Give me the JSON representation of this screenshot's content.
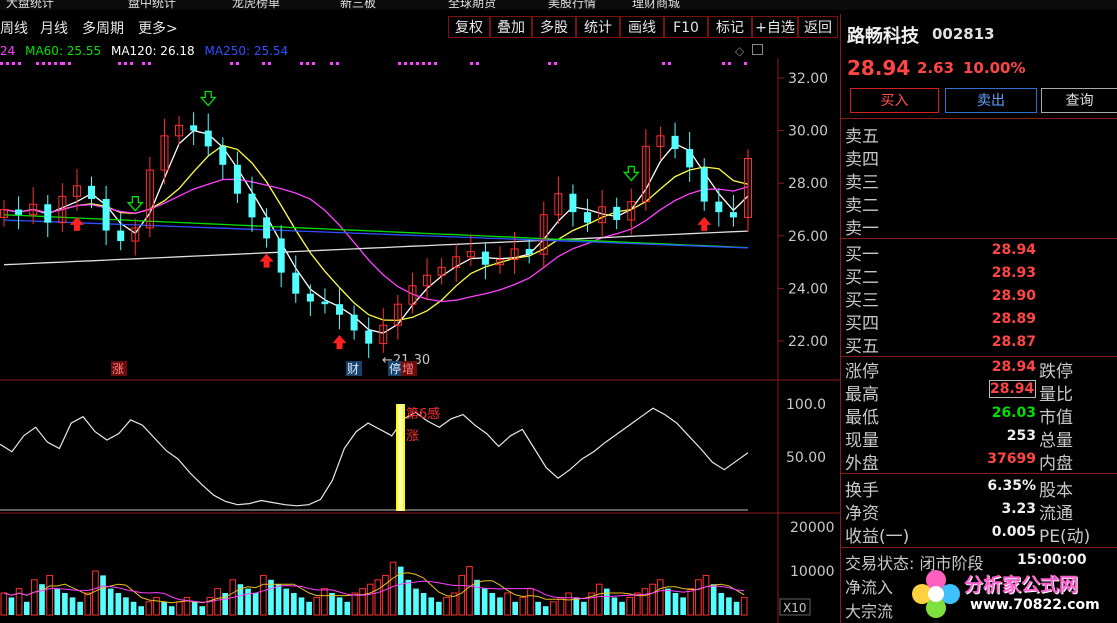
{
  "menu": {
    "items": [
      "大盘统计",
      "盘中统计",
      "龙虎榜单",
      "新三板",
      "全球期货",
      "美股行情",
      "理财商城"
    ]
  },
  "toolbar": {
    "left_items": [
      "周线",
      "月线",
      "多周期",
      "更多>"
    ],
    "buttons": [
      "复权",
      "叠加",
      "多股",
      "统计",
      "画线",
      "F10",
      "标记",
      "+自选",
      "返回"
    ]
  },
  "ma_legend": {
    "prefix": "24",
    "ma60": "MA60: 25.55",
    "ma120": "MA120: 26.18",
    "ma250": "MA250: 25.54",
    "colors": {
      "prefix": "#ff40ff",
      "ma60": "#00e000",
      "ma120": "#ffffff",
      "ma250": "#3050ff"
    }
  },
  "main_chart": {
    "y_ticks": [
      "32.00",
      "30.00",
      "28.00",
      "26.00",
      "24.00",
      "22.00"
    ],
    "low_label": "←21.30",
    "markers": [
      "涨",
      "财",
      "停",
      "增"
    ]
  },
  "indicator": {
    "y_ticks": [
      "100.0",
      "50.00"
    ],
    "signal_text_1": "第6感",
    "signal_text_2": "涨"
  },
  "volume": {
    "y_ticks": [
      "20000",
      "10000"
    ],
    "unit": "X10"
  },
  "chart_data": [
    {
      "type": "candlestick",
      "title": "",
      "y_range": [
        21,
        33
      ],
      "y_ticks": [
        32,
        30,
        28,
        26,
        24,
        22
      ],
      "close_approx": [
        27.0,
        26.8,
        27.2,
        26.5,
        27.5,
        27.9,
        27.4,
        26.2,
        25.8,
        26.3,
        28.5,
        29.8,
        30.2,
        30.0,
        29.4,
        28.7,
        27.6,
        26.7,
        25.9,
        24.6,
        23.8,
        23.5,
        23.4,
        23.0,
        22.4,
        21.9,
        22.6,
        23.4,
        24.1,
        24.5,
        24.8,
        25.2,
        25.4,
        24.9,
        25.1,
        25.5,
        25.3,
        26.8,
        27.6,
        26.9,
        26.5,
        27.1,
        26.6,
        27.3,
        29.4,
        29.8,
        29.3,
        28.6,
        27.3,
        26.9,
        26.7,
        28.94
      ],
      "low_marked": 21.3,
      "ma_values": {
        "MA60": 25.55,
        "MA120": 26.18,
        "MA250": 25.54
      }
    },
    {
      "type": "line",
      "title": "",
      "y_range": [
        0,
        110
      ],
      "y_ticks": [
        100,
        50
      ],
      "signal_bar": {
        "value": 100
      }
    },
    {
      "type": "bar",
      "title": "",
      "y_range": [
        0,
        22000
      ],
      "y_ticks": [
        20000,
        10000
      ],
      "unit": "X10"
    }
  ],
  "quote": {
    "name": "路畅科技",
    "code": "002813",
    "price": "28.94",
    "change": "2.63",
    "pct": "10.00%",
    "buy_btn": "买入",
    "sell_btn": "卖出",
    "query_btn": "查询"
  },
  "order_book": {
    "asks": [
      {
        "label": "卖五",
        "price": ""
      },
      {
        "label": "卖四",
        "price": ""
      },
      {
        "label": "卖三",
        "price": ""
      },
      {
        "label": "卖二",
        "price": ""
      },
      {
        "label": "卖一",
        "price": ""
      }
    ],
    "bids": [
      {
        "label": "买一",
        "price": "28.94"
      },
      {
        "label": "买二",
        "price": "28.93"
      },
      {
        "label": "买三",
        "price": "28.90"
      },
      {
        "label": "买四",
        "price": "28.89"
      },
      {
        "label": "买五",
        "price": "28.87"
      }
    ]
  },
  "stats": [
    {
      "label": "涨停",
      "value": "28.94",
      "label2": "跌停"
    },
    {
      "label": "最高",
      "value": "28.94",
      "label2": "量比"
    },
    {
      "label": "最低",
      "value": "26.03",
      "label2": "市值"
    },
    {
      "label": "现量",
      "value": "253",
      "label2": "总量"
    },
    {
      "label": "外盘",
      "value": "37699",
      "label2": "内盘"
    }
  ],
  "stats2": [
    {
      "label": "换手",
      "value": "6.35%",
      "label2": "股本"
    },
    {
      "label": "净资",
      "value": "3.23",
      "label2": "流通"
    },
    {
      "label": "收益(一)",
      "value": "0.005",
      "label2": "PE(动)"
    }
  ],
  "status": {
    "trade_label": "交易状态: 闭市阶段",
    "trade_time": "15:00:00",
    "net_inflow": "净流入",
    "block_trade": "大宗流"
  },
  "watermark": {
    "text": "分析家公式网",
    "url": "www.70822.com"
  }
}
